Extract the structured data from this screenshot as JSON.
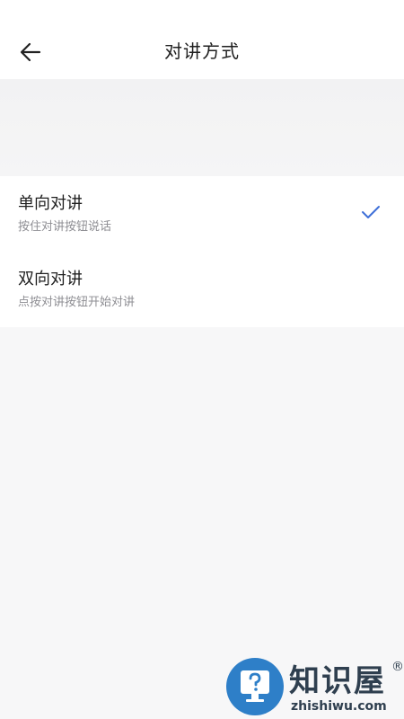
{
  "header": {
    "title": "对讲方式",
    "back_icon": "arrow-left-icon"
  },
  "options": [
    {
      "label": "单向对讲",
      "description": "按住对讲按钮说话",
      "selected": true
    },
    {
      "label": "双向对讲",
      "description": "点按对讲按钮开始对讲",
      "selected": false
    }
  ],
  "colors": {
    "accent": "#3e6fd8",
    "background": "#f7f7f8",
    "card": "#ffffff",
    "secondary_text": "#8e8e93"
  },
  "watermark": {
    "brand": "知识屋",
    "domain": "zhishiwu.com",
    "mark": "®"
  }
}
